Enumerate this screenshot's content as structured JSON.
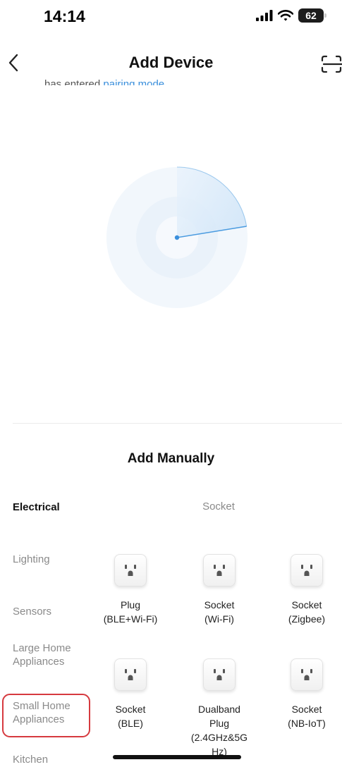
{
  "status": {
    "time": "14:14",
    "battery": "62"
  },
  "nav": {
    "title": "Add Device",
    "back_icon": "chevron-left-icon",
    "scan_icon": "scan-icon"
  },
  "clipped_text": {
    "prefix": "has entered ",
    "accent": "pairing mode"
  },
  "colors": {
    "accent": "#3a8fdc",
    "highlight": "#d63a3f",
    "radar": "#4a9be0"
  },
  "manual": {
    "title": "Add Manually"
  },
  "categories": [
    {
      "label": "Electrical",
      "active": true
    },
    {
      "label": "Lighting"
    },
    {
      "label": "Sensors"
    },
    {
      "label": "Large Home Appliances"
    },
    {
      "label": "Small Home Appliances",
      "highlighted": true
    },
    {
      "label": "Kitchen Appliances"
    }
  ],
  "subcategory": {
    "title": "Socket"
  },
  "devices": [
    {
      "line1": "Plug",
      "line2": "(BLE+Wi-Fi)",
      "icon": "socket-icon"
    },
    {
      "line1": "Socket",
      "line2": "(Wi-Fi)",
      "icon": "socket-icon"
    },
    {
      "line1": "Socket",
      "line2": "(Zigbee)",
      "icon": "socket-icon"
    },
    {
      "line1": "Socket",
      "line2": "(BLE)",
      "icon": "socket-icon"
    },
    {
      "line1": "Dualband",
      "line2": "Plug",
      "line3": "(2.4GHz&5G",
      "line4": "Hz)",
      "icon": "socket-icon"
    },
    {
      "line1": "Socket",
      "line2": "(NB-IoT)",
      "icon": "socket-icon"
    }
  ]
}
